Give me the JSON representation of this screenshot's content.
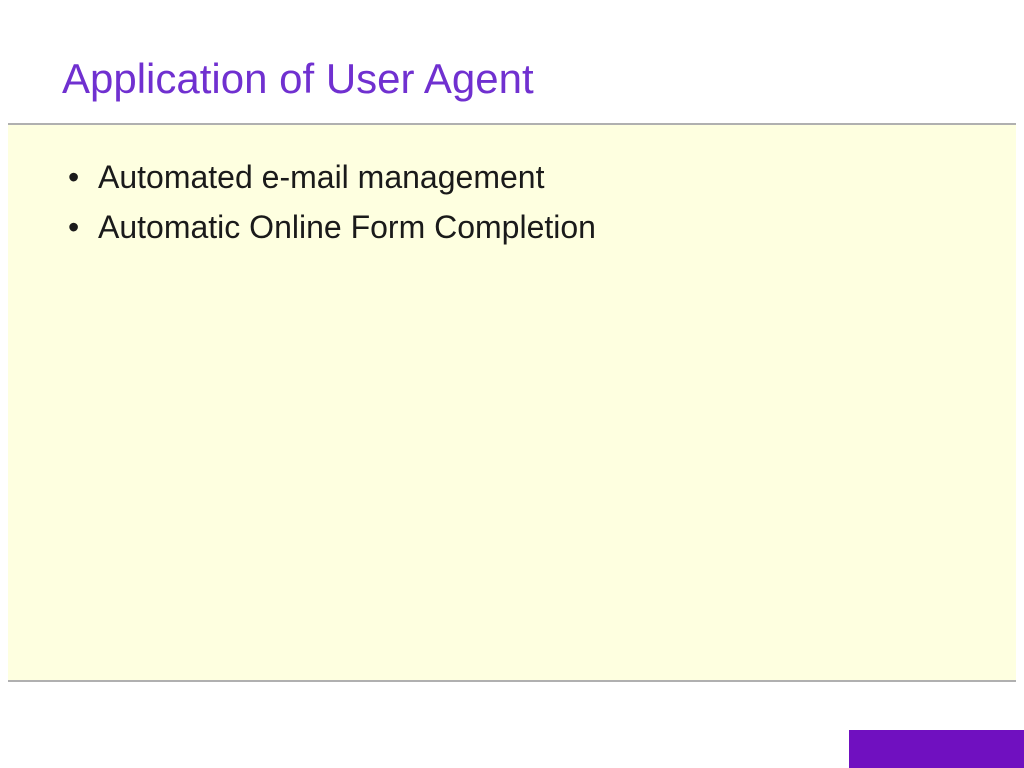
{
  "slide": {
    "title": "Application of User Agent",
    "bullets": [
      "Automated e-mail management",
      "Automatic Online Form Completion"
    ]
  }
}
